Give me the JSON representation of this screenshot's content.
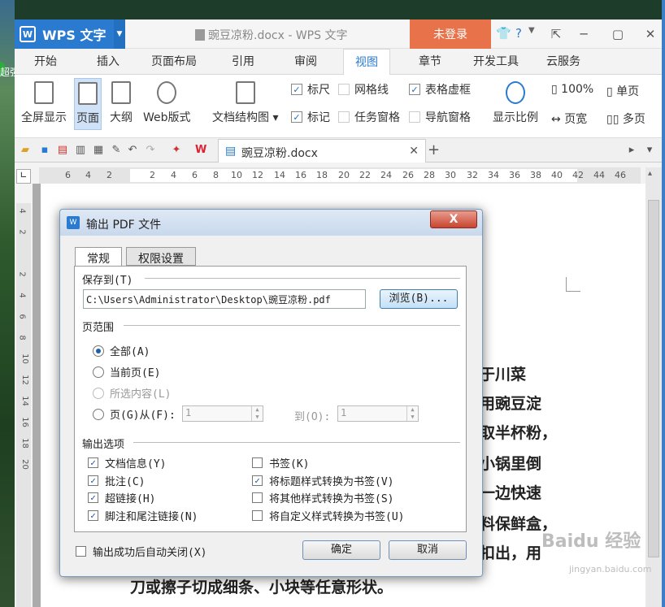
{
  "desktop": {
    "label": "超强"
  },
  "titlebar": {
    "app_name": "WPS 文字",
    "doc_title": "豌豆凉粉.docx - WPS 文字",
    "login": "未登录"
  },
  "menu": [
    "开始",
    "插入",
    "页面布局",
    "引用",
    "审阅",
    "视图",
    "章节",
    "开发工具",
    "云服务"
  ],
  "ribbon": {
    "fullscreen": "全屏显示",
    "page": "页面",
    "outline": "大纲",
    "web": "Web版式",
    "doc_structure": "文档结构图",
    "ruler": "标尺",
    "gridlines": "网格线",
    "table_gridlines": "表格虚框",
    "markup": "标记",
    "task_pane": "任务窗格",
    "nav_pane": "导航窗格",
    "zoom_display": "显示比例",
    "zoom_100": "100%",
    "single_page": "单页",
    "page_width": "页宽",
    "multi_page": "多页"
  },
  "doc_tab": {
    "name": "豌豆凉粉.docx"
  },
  "ruler": {
    "h": [
      "6",
      "4",
      "2",
      "2",
      "4",
      "6",
      "8",
      "10",
      "12",
      "14",
      "16",
      "18",
      "20",
      "22",
      "24",
      "26",
      "28",
      "30",
      "32",
      "34",
      "36",
      "38",
      "40",
      "42",
      "44",
      "46"
    ],
    "v": [
      "4",
      "2",
      "2",
      "4",
      "6",
      "8",
      "10",
      "12",
      "14",
      "16",
      "18",
      "20"
    ]
  },
  "document": {
    "lines": [
      "于川菜",
      "用豌豆淀",
      "取半杯粉，",
      "小锅里倒",
      "一边快速",
      "料保鲜盒，",
      "扣出，用",
      "刀或擦子切成细条、小块等任意形状。"
    ]
  },
  "watermark": {
    "text": "Baidu 经验",
    "url": "jingyan.baidu.com"
  },
  "dialog": {
    "title": "输出 PDF 文件",
    "close": "X",
    "tabs": [
      "常规",
      "权限设置"
    ],
    "save_to_label": "保存到(T)",
    "path": "C:\\Users\\Administrator\\Desktop\\豌豆凉粉.pdf",
    "browse": "浏览(B)...",
    "range_label": "页范围",
    "range_all": "全部(A)",
    "range_current": "当前页(E)",
    "range_selection": "所选内容(L)",
    "range_pages": "页(G)从(F):",
    "range_from": "1",
    "range_to_label": "到(O):",
    "range_to": "1",
    "output_label": "输出选项",
    "options": [
      {
        "label": "文档信息(Y)",
        "checked": true
      },
      {
        "label": "批注(C)",
        "checked": true
      },
      {
        "label": "超链接(H)",
        "checked": true
      },
      {
        "label": "脚注和尾注链接(N)",
        "checked": true
      },
      {
        "label": "书签(K)",
        "checked": false
      },
      {
        "label": "将标题样式转换为书签(V)",
        "checked": true
      },
      {
        "label": "将其他样式转换为书签(S)",
        "checked": false
      },
      {
        "label": "将自定义样式转换为书签(U)",
        "checked": false
      }
    ],
    "auto_close": "输出成功后自动关闭(X)",
    "ok": "确定",
    "cancel": "取消"
  }
}
